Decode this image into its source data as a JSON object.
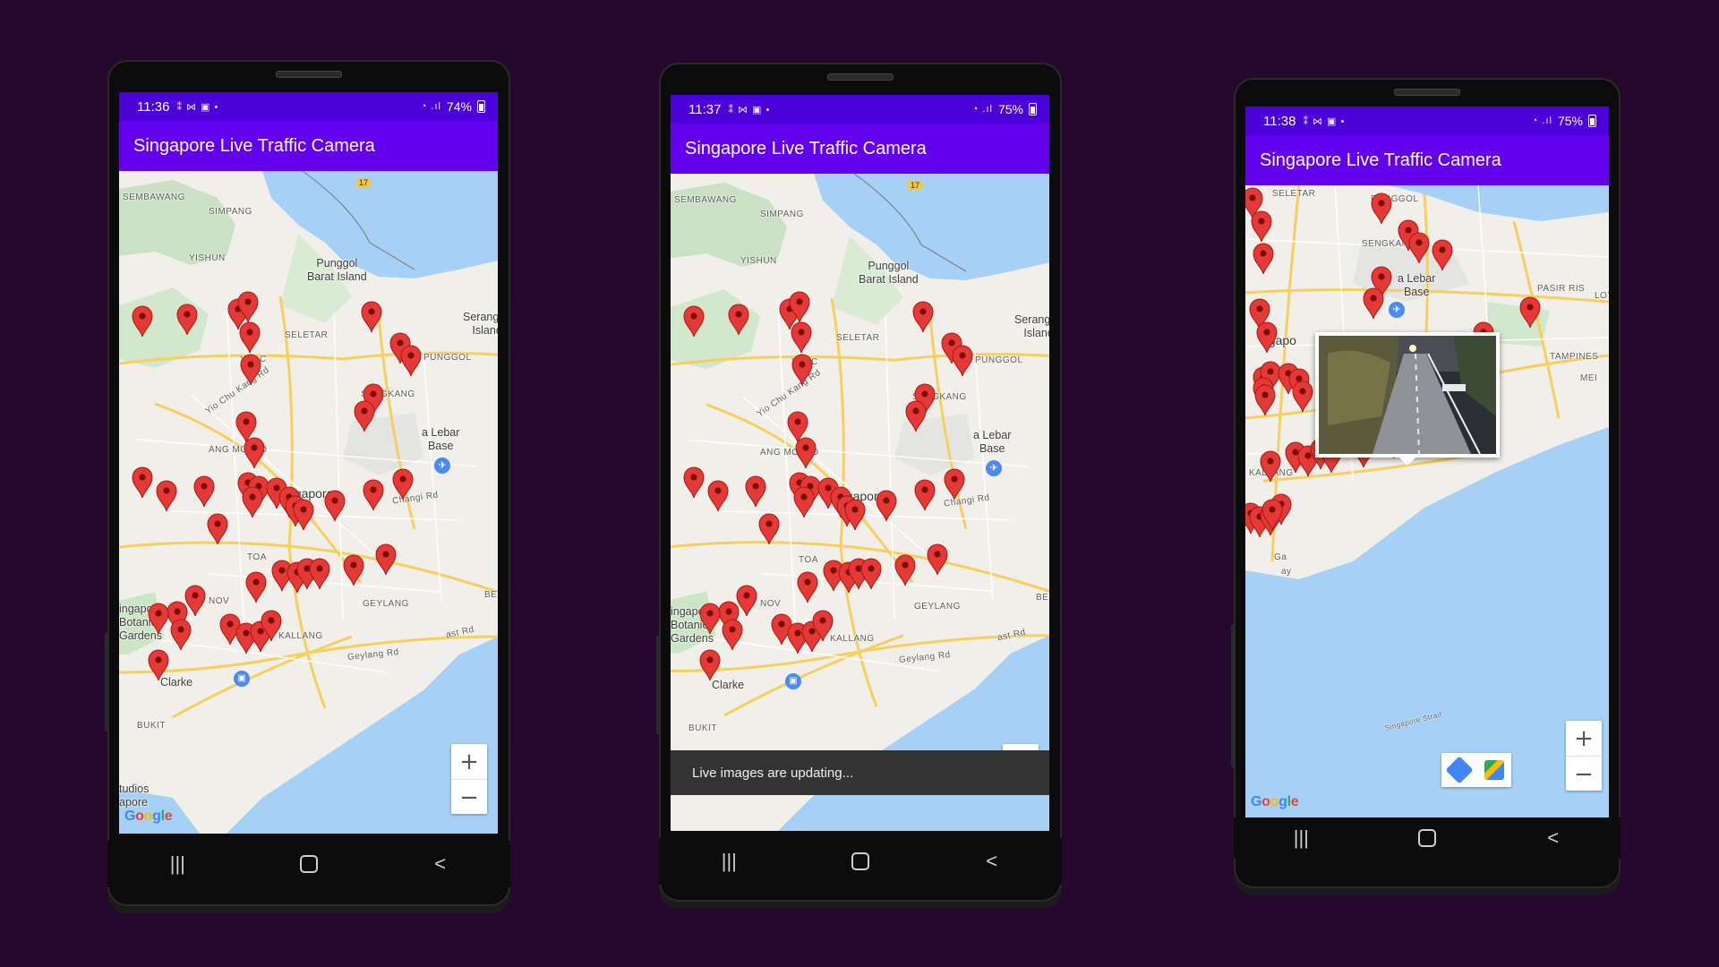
{
  "app": {
    "title": "Singapore Live Traffic Camera",
    "accent": "#6200ee",
    "statusbar_color": "#4a02d8"
  },
  "phones": [
    {
      "time": "11:36",
      "battery": "74%"
    },
    {
      "time": "11:37",
      "battery": "75%"
    },
    {
      "time": "11:38",
      "battery": "75%"
    }
  ],
  "map_labels": {
    "sembawang": "SEMBAWANG",
    "simpang": "SIMPANG",
    "yishun": "YISHUN",
    "punggol_island_1": "Punggol",
    "punggol_island_2": "Barat Island",
    "seletar": "SELETAR",
    "serangoon_1": "Serangoo",
    "serangoon_2": "Island",
    "punggol": "PUNGGOL",
    "sengkang": "SENGKANG",
    "ang_mo_kio": "ANG MO KIO",
    "paya_lebar_1": "a Lebar",
    "paya_lebar_2": "Base",
    "singapore": "ngapore",
    "toa": "TOA",
    "novena": "NOV",
    "geylang": "GEYLANG",
    "botanic_1": "ingapore",
    "botanic_2": "Botanic",
    "botanic_3": "Gardens",
    "kallang": "KALLANG",
    "clarke": "Clarke",
    "bukit": "BUKIT",
    "gardens_bay": "Ga",
    "bay": "ay",
    "studios": "tudios",
    "apore": "apore",
    "pasir_ris": "PASIR RIS",
    "tampines": "TAMPINES",
    "loyang": "LOYA",
    "route_17": "17",
    "yio_chu_kang": "Yio Chu Kang Rd",
    "changi": "Changi Rd",
    "geylang_rd": "Geylang Rd",
    "east_rd": "ast Rd",
    "singapore_strait": "Singapore Strait",
    "bedok": "BE",
    "mei": "MEI",
    "yio": "YIO C",
    "ng_cpore": "ngapo"
  },
  "google_logo": "Google",
  "zoom": {
    "in": "+",
    "out": "−"
  },
  "snackbar": {
    "text": "Live images are updating..."
  },
  "nav": {
    "recents": "|||",
    "back": "<"
  },
  "icons": {
    "marker": "map-marker-icon",
    "airport": "airplane-icon",
    "directions": "directions-icon",
    "maps": "google-maps-icon"
  }
}
